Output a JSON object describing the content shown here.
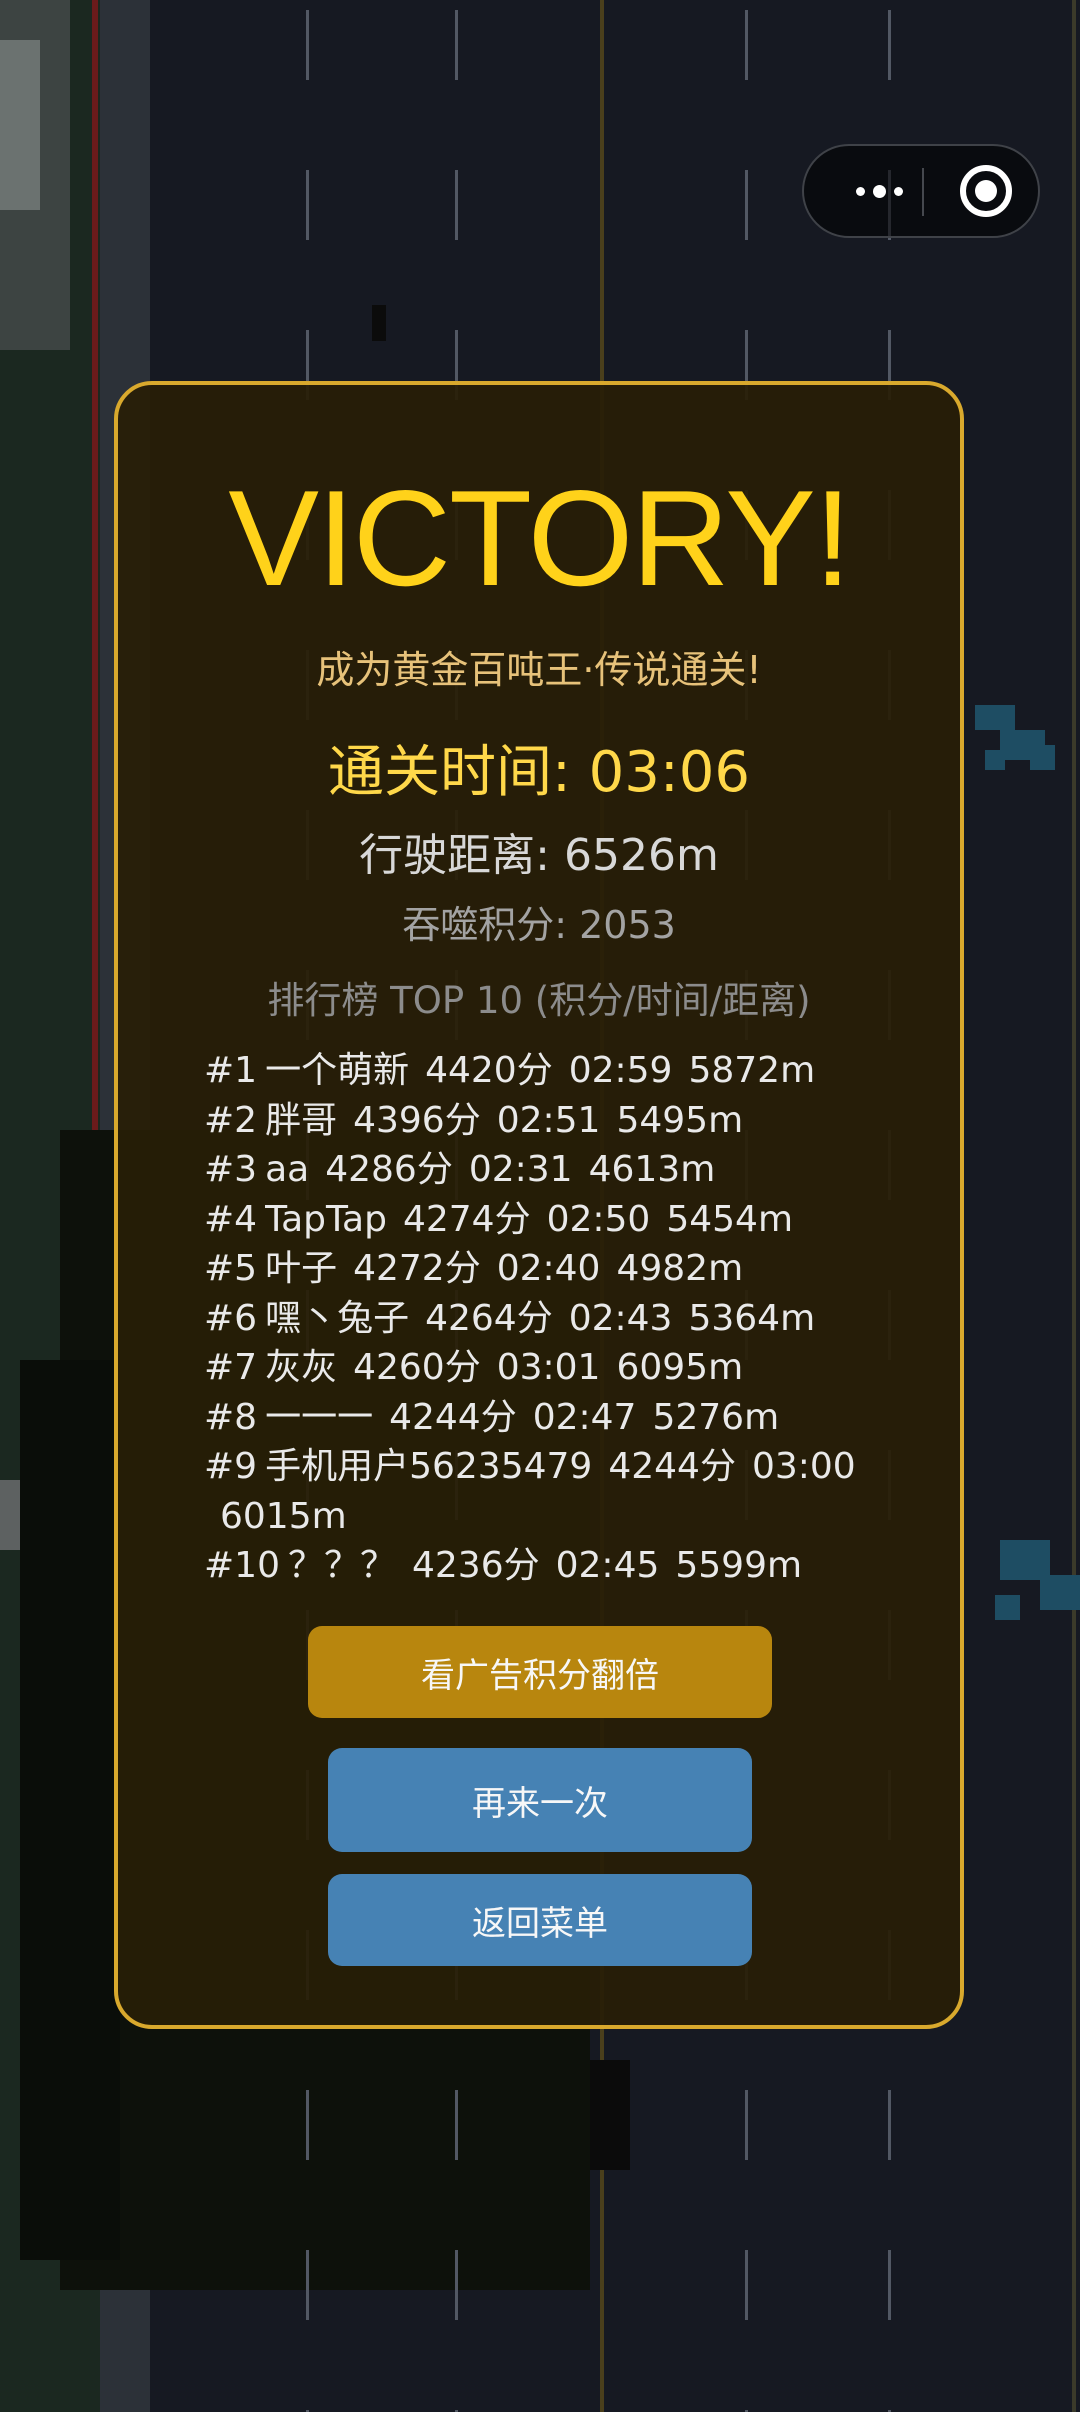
{
  "capsule": {
    "more_icon": "more-dots-icon",
    "close_icon": "target-circle-icon"
  },
  "result": {
    "title": "VICTORY!",
    "subtitle": "成为黄金百吨王·传说通关!",
    "time_text": "通关时间: 03:06",
    "distance_text": "行驶距离: 6526m",
    "score_text": "吞噬积分: 2053"
  },
  "leaderboard": {
    "title": "排行榜 TOP 10 (积分/时间/距离)",
    "rows": [
      {
        "rank": "#1",
        "name": "一个萌新",
        "score": "4420分",
        "time": "02:59",
        "distance": "5872m"
      },
      {
        "rank": "#2",
        "name": "胖哥",
        "score": "4396分",
        "time": "02:51",
        "distance": "5495m"
      },
      {
        "rank": "#3",
        "name": "aa",
        "score": "4286分",
        "time": "02:31",
        "distance": "4613m"
      },
      {
        "rank": "#4",
        "name": "TapTap",
        "score": "4274分",
        "time": "02:50",
        "distance": "5454m"
      },
      {
        "rank": "#5",
        "name": "叶子",
        "score": "4272分",
        "time": "02:40",
        "distance": "4982m"
      },
      {
        "rank": "#6",
        "name": "嘿丶兔子",
        "score": "4264分",
        "time": "02:43",
        "distance": "5364m"
      },
      {
        "rank": "#7",
        "name": "灰灰",
        "score": "4260分",
        "time": "03:01",
        "distance": "6095m"
      },
      {
        "rank": "#8",
        "name": "一一一",
        "score": "4244分",
        "time": "02:47",
        "distance": "5276m"
      },
      {
        "rank": "#9",
        "name": "手机用户56235479",
        "score": "4244分",
        "time": "03:00",
        "distance": "6015m"
      },
      {
        "rank": "#10",
        "name": "？？？",
        "score": "4236分",
        "time": "02:45",
        "distance": "5599m"
      }
    ]
  },
  "buttons": {
    "double_ad": "看广告积分翻倍",
    "retry": "再来一次",
    "menu": "返回菜单"
  },
  "colors": {
    "accent_gold": "#ffd21a",
    "panel_border": "#d9a92d",
    "ad_button": "#b8860e",
    "blue_button": "#4682b4"
  }
}
